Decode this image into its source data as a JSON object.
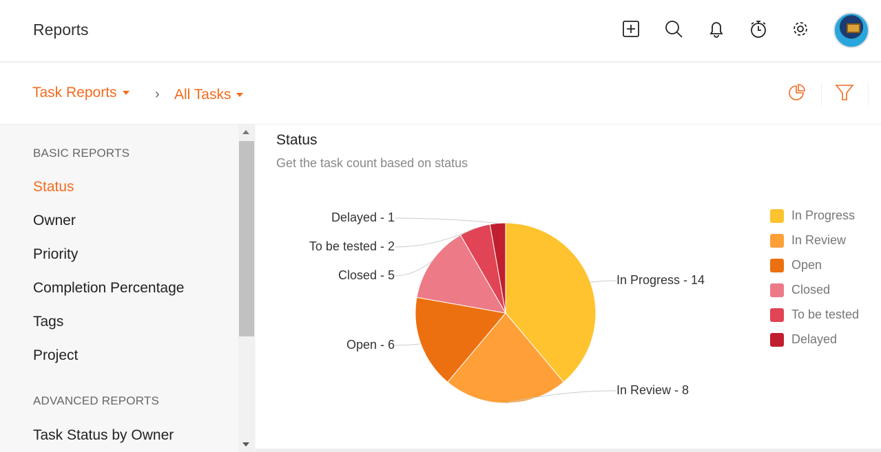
{
  "header": {
    "title": "Reports",
    "icons": [
      "add-icon",
      "search-icon",
      "bell-icon",
      "timer-icon",
      "gear-icon"
    ]
  },
  "breadcrumb": {
    "report_type": "Task Reports",
    "view": "All Tasks"
  },
  "toolbar": {
    "icons": [
      "pie-chart-icon",
      "filter-icon"
    ],
    "accent": "#f26b1d"
  },
  "sidebar": {
    "basic_heading": "BASIC REPORTS",
    "basic_items": [
      {
        "label": "Status",
        "active": true
      },
      {
        "label": "Owner"
      },
      {
        "label": "Priority"
      },
      {
        "label": "Completion Percentage"
      },
      {
        "label": "Tags"
      },
      {
        "label": "Project"
      }
    ],
    "advanced_heading": "ADVANCED REPORTS",
    "advanced_items": [
      {
        "label": "Task Status by Owner"
      }
    ]
  },
  "main": {
    "title": "Status",
    "subtitle": "Get the task count based on status"
  },
  "chart_data": {
    "type": "pie",
    "categories": [
      "In Progress",
      "In Review",
      "Open",
      "Closed",
      "To be tested",
      "Delayed"
    ],
    "values": [
      14,
      8,
      6,
      5,
      2,
      1
    ],
    "colors": [
      "#fec32e",
      "#fe9f37",
      "#ec700f",
      "#ec7a87",
      "#e04455",
      "#c01f2f"
    ],
    "data_labels": [
      "In Progress - 14",
      "In Review - 8",
      "Open - 6",
      "Closed - 5",
      "To be tested - 2",
      "Delayed - 1"
    ],
    "legend": "right"
  }
}
